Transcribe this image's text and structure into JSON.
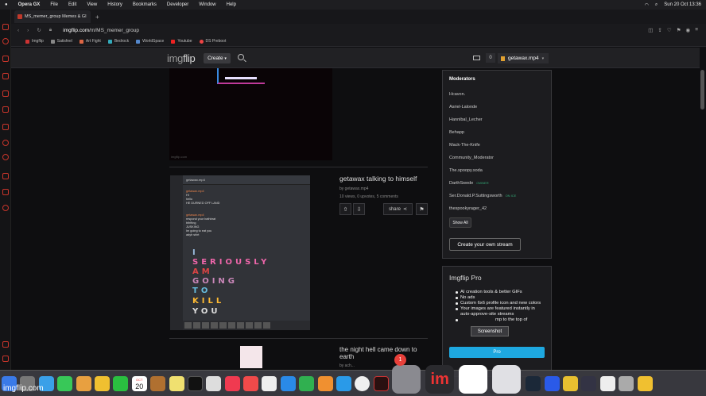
{
  "menubar": {
    "app": "Opera GX",
    "items": [
      "File",
      "Edit",
      "View",
      "History",
      "Bookmarks",
      "Developer",
      "Window",
      "Help"
    ],
    "datetime": "Sun 20 Oct  13:36"
  },
  "browser": {
    "tab_title": "MS_memer_group Memes & GI",
    "url_host": "imgflip.com",
    "url_path": "/m/MS_memer_group",
    "bookmarks": [
      "Imgflip",
      "Satisfeel",
      "Art Fight",
      "Bedrock",
      "WorldSpace",
      "Youtube",
      "DS Preboot"
    ]
  },
  "header": {
    "logo_a": "img",
    "logo_b": "flip",
    "create_label": "Create",
    "notifications": "0",
    "username": "getawax.mp4"
  },
  "post1": {
    "watermark": "imgflip.com"
  },
  "post2": {
    "chat_header": "getawax.mp4",
    "messages": [
      {
        "name": "getawax.mp4",
        "lines": [
          "HI",
          "hello",
          "HE DURNED OFF LAND"
        ]
      },
      {
        "name": "getawax.mp4",
        "lines": [
          "respond your bathbrat",
          "bthfting",
          "JUSKING",
          "Im going to eat you",
          "adyh shirt"
        ]
      }
    ],
    "big_text": [
      "I",
      "SERIOUSLY",
      "AM",
      "GOING",
      "TO",
      "KILL",
      "YOU"
    ],
    "title": "getawax talking to himself",
    "by": "by getawax.mp4",
    "stats": "10 views, 0 upvotes, 5 comments",
    "share_label": "share"
  },
  "post3": {
    "title": "the night hell came down to earth",
    "by": "by ach..."
  },
  "moderators": {
    "heading": "Moderators",
    "list": [
      {
        "name": "Hcavon.",
        "tag": ""
      },
      {
        "name": "Asriel-Lalonde",
        "tag": ""
      },
      {
        "name": "Hannibal_Lecher",
        "tag": ""
      },
      {
        "name": "Behapp",
        "tag": ""
      },
      {
        "name": "Mack-The-Knife",
        "tag": ""
      },
      {
        "name": "Community_Moderator",
        "tag": ""
      },
      {
        "name": "The.spoopy.soda",
        "tag": ""
      },
      {
        "name": "DarthSwede",
        "tag": "OWNER"
      },
      {
        "name": "Ser.Donald.P.Suttingsworth",
        "tag": "ON ICE"
      },
      {
        "name": "thespookyrager_42",
        "tag": ""
      }
    ],
    "show_all": "Show All",
    "create_stream": "Create your own stream"
  },
  "pro": {
    "title": "Imgflip Pro",
    "features": [
      "AI creation tools & better GIFs",
      "No ads",
      "Custom 6x6 profile icon and new colors",
      "Your images are featured instantly in auto-approve-site streams",
      "mp to the top of"
    ],
    "button": "Pro",
    "tooltip": "Screenshot"
  },
  "dock": {
    "calendar_month": "OCT",
    "calendar_day": "20",
    "settings_badge": "1"
  },
  "watermark": "imgflip.com",
  "colors": {
    "accent_blue": "#1ea8e0",
    "gx_red": "#c7352b",
    "owner_green": "#33aa77"
  }
}
